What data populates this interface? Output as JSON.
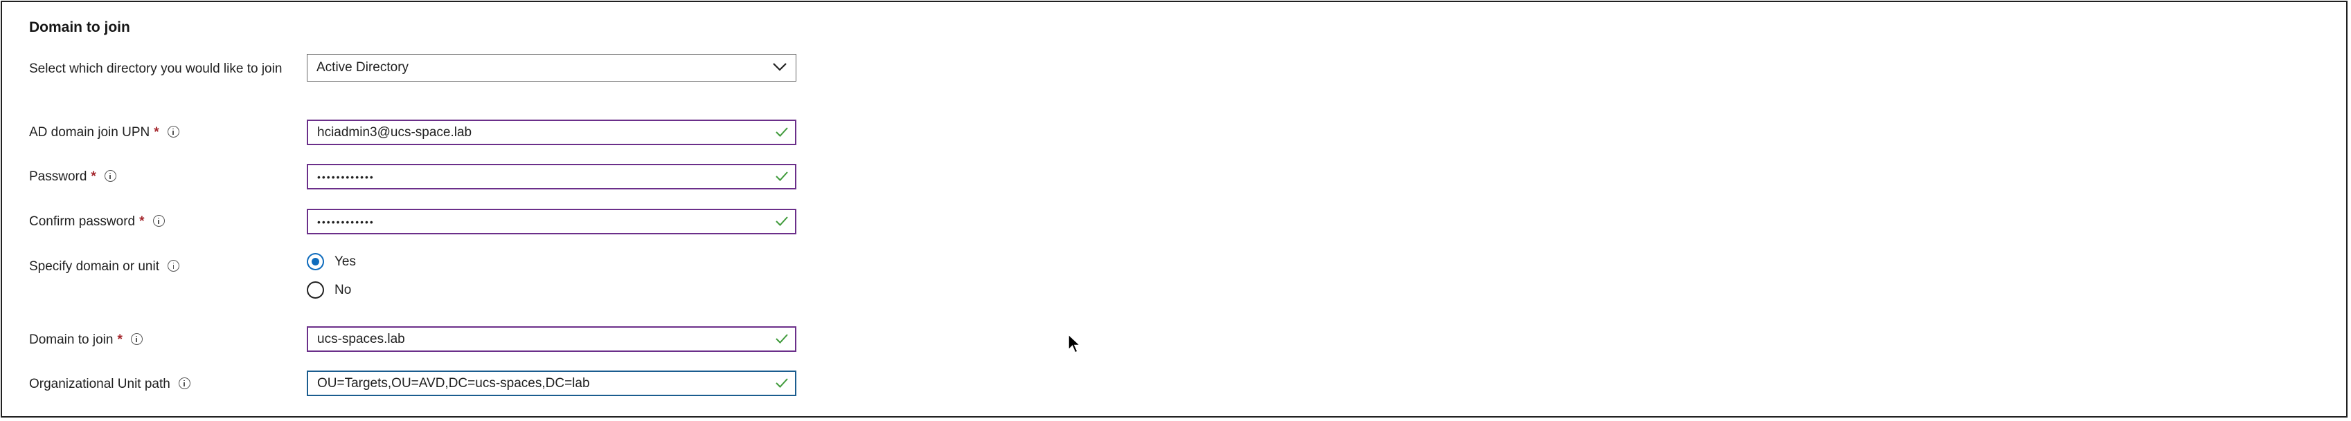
{
  "section": {
    "title": "Domain to join"
  },
  "directory": {
    "label": "Select which directory you would like to join",
    "value": "Active Directory",
    "chevron_icon": "chevron-down-icon"
  },
  "upn": {
    "label": "AD domain join UPN",
    "required": "*",
    "value": "hciadmin3@ucs-space.lab"
  },
  "password": {
    "label": "Password",
    "required": "*",
    "value": "••••••••••••"
  },
  "confirm_password": {
    "label": "Confirm password",
    "required": "*",
    "value": "••••••••••••"
  },
  "specify": {
    "label": "Specify domain or unit",
    "options": [
      {
        "label": "Yes",
        "selected": true
      },
      {
        "label": "No",
        "selected": false
      }
    ]
  },
  "domain": {
    "label": "Domain to join",
    "required": "*",
    "value": "ucs-spaces.lab"
  },
  "ou": {
    "label": "Organizational Unit path",
    "value": "OU=Targets,OU=AVD,DC=ucs-spaces,DC=lab"
  },
  "colors": {
    "field_border": "#6b2f8a",
    "focus_border": "#1b5d8f",
    "check": "#3f9a3a",
    "required": "#a4262c",
    "radio": "#0f6cbd"
  }
}
